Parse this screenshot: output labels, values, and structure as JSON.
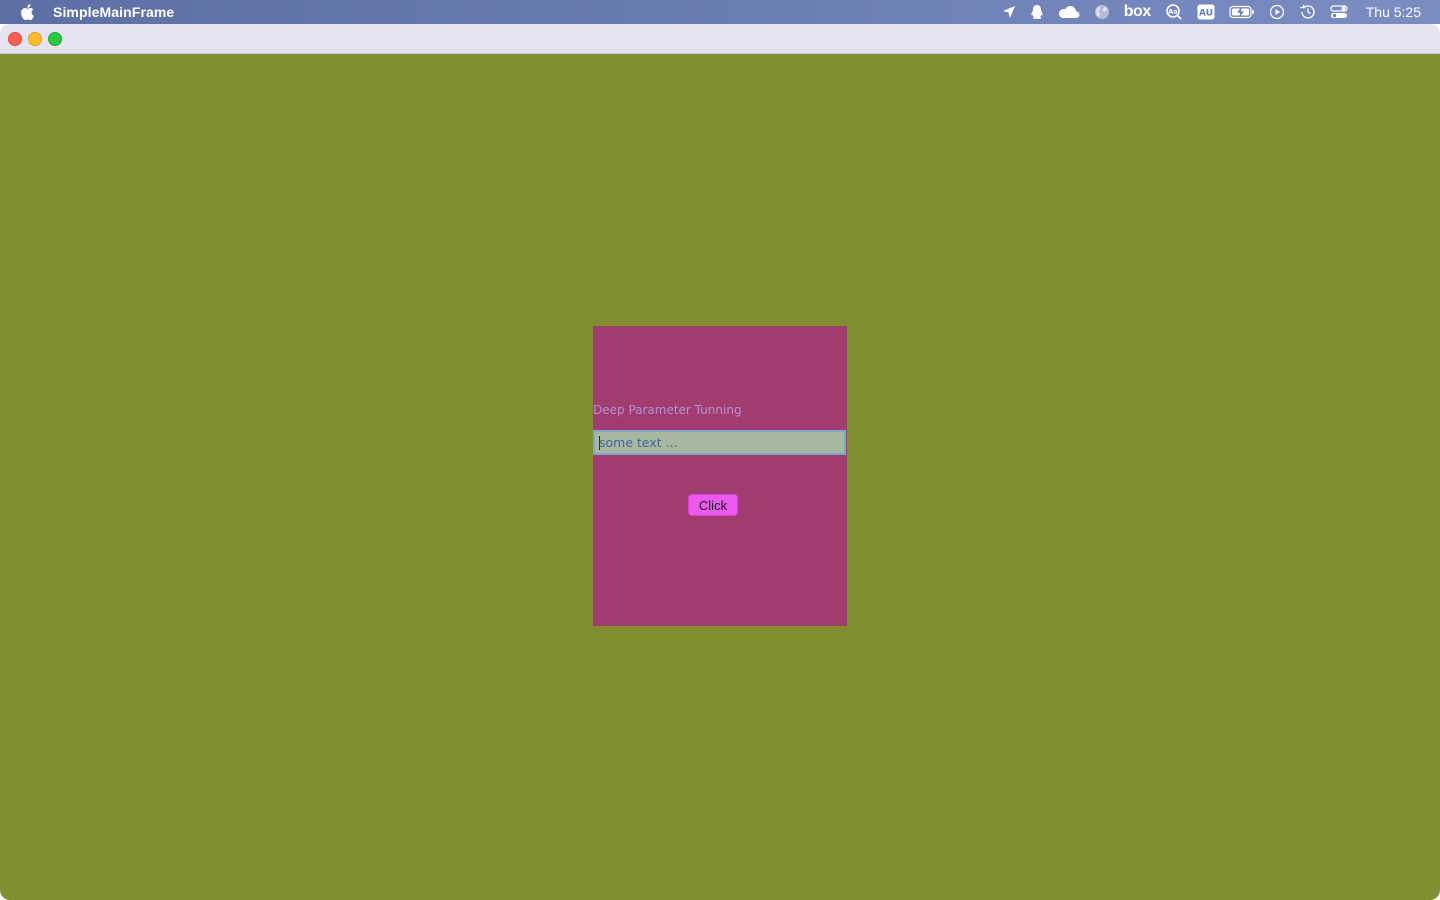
{
  "menubar": {
    "app_name": "SimpleMainFrame",
    "clock": "Thu 5:25",
    "status_icons": [
      "location-arrow-icon",
      "qq-penguin-icon",
      "onedrive-cloud-icon",
      "globe-icon",
      "box-icon",
      "text-recognition-icon",
      "au-icon",
      "battery-charging-icon",
      "play-circle-icon",
      "time-machine-icon",
      "control-center-icon"
    ],
    "box_label": "box",
    "au_label": "AU"
  },
  "window": {
    "background": "#818f32"
  },
  "panel": {
    "background": "#a13d6e",
    "label": "Deep Parameter Tunning",
    "text_field_value": "some text ...",
    "button_label": "Click",
    "button_color": "#ec59ee"
  }
}
